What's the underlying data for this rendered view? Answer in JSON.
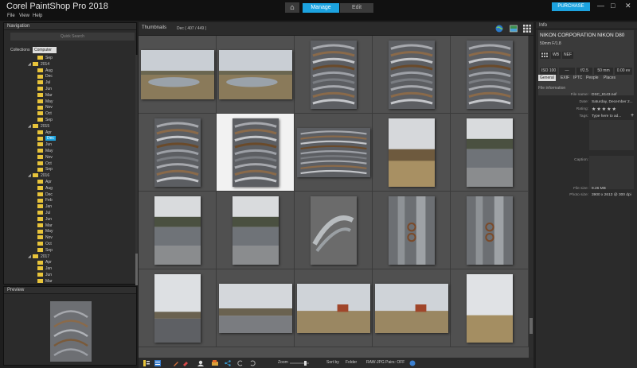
{
  "app": {
    "title": "Corel PaintShop Pro 2018",
    "home_label": "⌂",
    "tabs": [
      "Manage",
      "Edit"
    ],
    "purchase_label": "PURCHASE",
    "window_controls": [
      "—",
      "□",
      "✕"
    ]
  },
  "menu": [
    "File",
    "View",
    "Help"
  ],
  "navigation": {
    "title": "Navigation",
    "search_placeholder": "Quick Search",
    "tabs": [
      "Collections",
      "Computer"
    ],
    "tree": [
      {
        "label": "Sep",
        "level": 2
      },
      {
        "label": "2014",
        "level": 1
      },
      {
        "label": "Aug",
        "level": 2
      },
      {
        "label": "Dec",
        "level": 2
      },
      {
        "label": "Jul",
        "level": 2
      },
      {
        "label": "Jun",
        "level": 2
      },
      {
        "label": "Mar",
        "level": 2
      },
      {
        "label": "May",
        "level": 2
      },
      {
        "label": "Nov",
        "level": 2
      },
      {
        "label": "Oct",
        "level": 2
      },
      {
        "label": "Sep",
        "level": 2
      },
      {
        "label": "2015",
        "level": 1
      },
      {
        "label": "Apr",
        "level": 2
      },
      {
        "label": "Dec",
        "level": 2,
        "selected": true
      },
      {
        "label": "Jun",
        "level": 2
      },
      {
        "label": "May",
        "level": 2
      },
      {
        "label": "Nov",
        "level": 2
      },
      {
        "label": "Oct",
        "level": 2
      },
      {
        "label": "Sep",
        "level": 2
      },
      {
        "label": "2016",
        "level": 1
      },
      {
        "label": "Apr",
        "level": 2
      },
      {
        "label": "Aug",
        "level": 2
      },
      {
        "label": "Dec",
        "level": 2
      },
      {
        "label": "Feb",
        "level": 2
      },
      {
        "label": "Jan",
        "level": 2
      },
      {
        "label": "Jul",
        "level": 2
      },
      {
        "label": "Jun",
        "level": 2
      },
      {
        "label": "Mar",
        "level": 2
      },
      {
        "label": "May",
        "level": 2
      },
      {
        "label": "Nov",
        "level": 2
      },
      {
        "label": "Oct",
        "level": 2
      },
      {
        "label": "Sep",
        "level": 2
      },
      {
        "label": "2017",
        "level": 1
      },
      {
        "label": "Apr",
        "level": 2
      },
      {
        "label": "Jan",
        "level": 2
      },
      {
        "label": "Jun",
        "level": 2
      },
      {
        "label": "Mar",
        "level": 2
      }
    ]
  },
  "preview": {
    "title": "Preview"
  },
  "thumbnails": {
    "title": "Thumbnails",
    "breadcrumb": "Dec ( 407 / 449 )",
    "items": [
      {
        "kind": "landscape-river",
        "orient": "land"
      },
      {
        "kind": "landscape-river",
        "orient": "land"
      },
      {
        "kind": "fungus",
        "orient": "port"
      },
      {
        "kind": "fungus",
        "orient": "port"
      },
      {
        "kind": "fungus",
        "orient": "port"
      },
      {
        "kind": "fungus",
        "orient": "port"
      },
      {
        "kind": "fungus",
        "orient": "port",
        "selected": true
      },
      {
        "kind": "fungus",
        "orient": "land"
      },
      {
        "kind": "field-trees",
        "orient": "port"
      },
      {
        "kind": "river",
        "orient": "port"
      },
      {
        "kind": "river",
        "orient": "port"
      },
      {
        "kind": "river",
        "orient": "port"
      },
      {
        "kind": "driftwood",
        "orient": "port"
      },
      {
        "kind": "chain-wood",
        "orient": "port"
      },
      {
        "kind": "chain-wood",
        "orient": "port"
      },
      {
        "kind": "road",
        "orient": "port"
      },
      {
        "kind": "road-land",
        "orient": "land"
      },
      {
        "kind": "barn",
        "orient": "land"
      },
      {
        "kind": "barn",
        "orient": "land"
      },
      {
        "kind": "field",
        "orient": "port"
      }
    ]
  },
  "bottombar": {
    "zoom_label": "Zoom",
    "sort_label": "Sort by",
    "sort_value": "Folder",
    "pairs_label": "RAW-JPG Pairs: OFF"
  },
  "info": {
    "title": "Info",
    "camera": "NIKON CORPORATION NIKON D80",
    "lens": "50mm F/1.8",
    "formats": [
      "WB",
      "NEF"
    ],
    "exposure": [
      "ISO 100",
      "—",
      "f/2.5",
      "50 mm",
      "0.00 ev"
    ],
    "tabs": [
      "General",
      "EXIF",
      "IPTC",
      "People",
      "Places"
    ],
    "section_title": "File information",
    "fields": [
      {
        "label": "File name:",
        "value": "DSC_8143.nef"
      },
      {
        "label": "Date:",
        "value": "Saturday, December 2..."
      },
      {
        "label": "Rating:",
        "value": "★★★★★"
      },
      {
        "label": "Tags:",
        "value": "Type here to ad..."
      },
      {
        "label": "Caption:",
        "value": ""
      },
      {
        "label": "File size:",
        "value": "9.26 MB"
      },
      {
        "label": "Photo size:",
        "value": "3900 x 2613 @ 300 dpi"
      }
    ]
  }
}
